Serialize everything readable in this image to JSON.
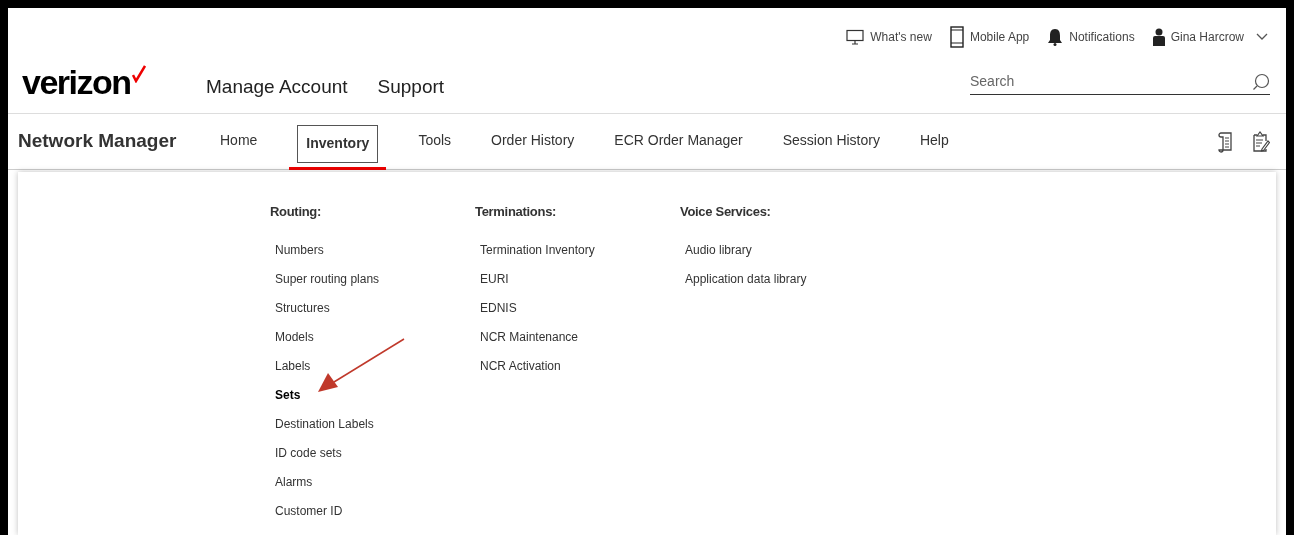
{
  "utility_bar": [
    {
      "kind": "monitor",
      "label": "What's new"
    },
    {
      "kind": "phone",
      "label": "Mobile App"
    },
    {
      "kind": "bell",
      "label": "Notifications"
    },
    {
      "kind": "user",
      "label": "Gina Harcrow"
    }
  ],
  "logo": {
    "text": "verizon"
  },
  "primary_nav": [
    "Manage Account",
    "Support"
  ],
  "search": {
    "placeholder": "Search"
  },
  "app_title": "Network Manager",
  "tabs": [
    {
      "label": "Home",
      "selected": false
    },
    {
      "label": "Inventory",
      "selected": true
    },
    {
      "label": "Tools",
      "selected": false
    },
    {
      "label": "Order History",
      "selected": false
    },
    {
      "label": "ECR Order Manager",
      "selected": false
    },
    {
      "label": "Session History",
      "selected": false
    },
    {
      "label": "Help",
      "selected": false
    }
  ],
  "menu_columns": [
    {
      "heading": "Routing:",
      "items": [
        {
          "label": "Numbers",
          "selected": false
        },
        {
          "label": "Super routing plans",
          "selected": false
        },
        {
          "label": "Structures",
          "selected": false
        },
        {
          "label": "Models",
          "selected": false
        },
        {
          "label": "Labels",
          "selected": false
        },
        {
          "label": "Sets",
          "selected": true
        },
        {
          "label": "Destination Labels",
          "selected": false
        },
        {
          "label": "ID code sets",
          "selected": false
        },
        {
          "label": "Alarms",
          "selected": false
        },
        {
          "label": "Customer ID",
          "selected": false
        }
      ]
    },
    {
      "heading": "Terminations:",
      "items": [
        {
          "label": "Termination Inventory",
          "selected": false
        },
        {
          "label": "EURI",
          "selected": false
        },
        {
          "label": "EDNIS",
          "selected": false
        },
        {
          "label": "NCR Maintenance",
          "selected": false
        },
        {
          "label": "NCR Activation",
          "selected": false
        }
      ]
    },
    {
      "heading": "Voice Services:",
      "items": [
        {
          "label": "Audio library",
          "selected": false
        },
        {
          "label": "Application data library",
          "selected": false
        }
      ]
    }
  ]
}
